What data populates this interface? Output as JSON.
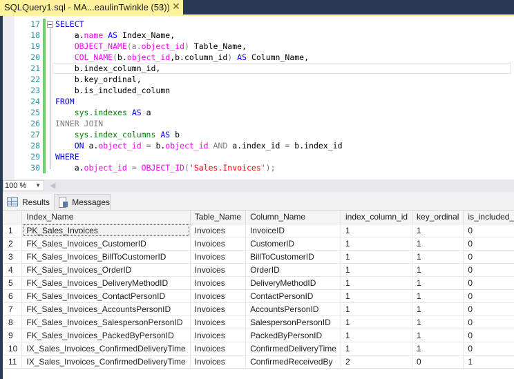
{
  "window": {
    "tab_title": "SQLQuery1.sql - MA...eaulinTwinkle (53))",
    "pin_icon": "pin-icon",
    "close_icon": "close-icon"
  },
  "editor": {
    "lines": [
      {
        "num": "17",
        "tokens": [
          {
            "t": "SELECT",
            "c": "kw"
          }
        ]
      },
      {
        "num": "18",
        "tokens": [
          {
            "t": "    a.",
            "c": ""
          },
          {
            "t": "name",
            "c": "fn"
          },
          {
            "t": " ",
            "c": ""
          },
          {
            "t": "AS",
            "c": "kw"
          },
          {
            "t": " Index_Name,",
            "c": ""
          }
        ]
      },
      {
        "num": "19",
        "tokens": [
          {
            "t": "    ",
            "c": ""
          },
          {
            "t": "OBJECT_NAME",
            "c": "fn"
          },
          {
            "t": "(a.",
            "c": "gr"
          },
          {
            "t": "object_id",
            "c": "fn"
          },
          {
            "t": ")",
            "c": "gr"
          },
          {
            "t": " Table_Name,",
            "c": ""
          }
        ]
      },
      {
        "num": "20",
        "tokens": [
          {
            "t": "    ",
            "c": ""
          },
          {
            "t": "COL_NAME",
            "c": "fn"
          },
          {
            "t": "(",
            "c": "gr"
          },
          {
            "t": "b.",
            "c": ""
          },
          {
            "t": "object_id",
            "c": "fn"
          },
          {
            "t": ",b.column_id",
            "c": ""
          },
          {
            "t": ") ",
            "c": "gr"
          },
          {
            "t": "AS",
            "c": "kw"
          },
          {
            "t": " Column_Name,",
            "c": ""
          }
        ]
      },
      {
        "num": "21",
        "tokens": [
          {
            "t": "    b.index_column_id,",
            "c": ""
          }
        ]
      },
      {
        "num": "22",
        "tokens": [
          {
            "t": "    b.key_ordinal,",
            "c": ""
          }
        ]
      },
      {
        "num": "23",
        "tokens": [
          {
            "t": "    b.is_included_column",
            "c": ""
          }
        ]
      },
      {
        "num": "24",
        "tokens": [
          {
            "t": "FROM",
            "c": "kw"
          }
        ]
      },
      {
        "num": "25",
        "tokens": [
          {
            "t": "    ",
            "c": ""
          },
          {
            "t": "sys.indexes",
            "c": "sys"
          },
          {
            "t": " ",
            "c": ""
          },
          {
            "t": "AS",
            "c": "kw"
          },
          {
            "t": " a",
            "c": ""
          }
        ]
      },
      {
        "num": "26",
        "tokens": [
          {
            "t": "INNER JOIN",
            "c": "gr"
          }
        ]
      },
      {
        "num": "27",
        "tokens": [
          {
            "t": "    ",
            "c": ""
          },
          {
            "t": "sys.index_columns",
            "c": "sys"
          },
          {
            "t": " ",
            "c": ""
          },
          {
            "t": "AS",
            "c": "kw"
          },
          {
            "t": " b",
            "c": ""
          }
        ]
      },
      {
        "num": "28",
        "tokens": [
          {
            "t": "    ",
            "c": ""
          },
          {
            "t": "ON",
            "c": "kw"
          },
          {
            "t": " a.",
            "c": ""
          },
          {
            "t": "object_id",
            "c": "fn"
          },
          {
            "t": " = ",
            "c": "gr"
          },
          {
            "t": "b.",
            "c": ""
          },
          {
            "t": "object_id",
            "c": "fn"
          },
          {
            "t": " AND ",
            "c": "gr"
          },
          {
            "t": "a.index_id ",
            "c": ""
          },
          {
            "t": "=",
            "c": "gr"
          },
          {
            "t": " b.index_id",
            "c": ""
          }
        ]
      },
      {
        "num": "29",
        "tokens": [
          {
            "t": "WHERE",
            "c": "kw"
          }
        ]
      },
      {
        "num": "30",
        "tokens": [
          {
            "t": "    a.",
            "c": ""
          },
          {
            "t": "object_id",
            "c": "fn"
          },
          {
            "t": " = ",
            "c": "gr"
          },
          {
            "t": "OBJECT_ID",
            "c": "fn"
          },
          {
            "t": "(",
            "c": "gr"
          },
          {
            "t": "'Sales.Invoices'",
            "c": "str"
          },
          {
            "t": ");",
            "c": "gr"
          }
        ]
      }
    ]
  },
  "zoom": {
    "value": "100 %"
  },
  "results": {
    "tabs": [
      {
        "label": "Results",
        "icon": "grid-icon",
        "active": true
      },
      {
        "label": "Messages",
        "icon": "messages-icon",
        "active": false
      }
    ],
    "columns": [
      "Index_Name",
      "Table_Name",
      "Column_Name",
      "index_column_id",
      "key_ordinal",
      "is_included_column"
    ],
    "rows": [
      [
        "1",
        "PK_Sales_Invoices",
        "Invoices",
        "InvoiceID",
        "1",
        "1",
        "0"
      ],
      [
        "2",
        "FK_Sales_Invoices_CustomerID",
        "Invoices",
        "CustomerID",
        "1",
        "1",
        "0"
      ],
      [
        "3",
        "FK_Sales_Invoices_BillToCustomerID",
        "Invoices",
        "BillToCustomerID",
        "1",
        "1",
        "0"
      ],
      [
        "4",
        "FK_Sales_Invoices_OrderID",
        "Invoices",
        "OrderID",
        "1",
        "1",
        "0"
      ],
      [
        "5",
        "FK_Sales_Invoices_DeliveryMethodID",
        "Invoices",
        "DeliveryMethodID",
        "1",
        "1",
        "0"
      ],
      [
        "6",
        "FK_Sales_Invoices_ContactPersonID",
        "Invoices",
        "ContactPersonID",
        "1",
        "1",
        "0"
      ],
      [
        "7",
        "FK_Sales_Invoices_AccountsPersonID",
        "Invoices",
        "AccountsPersonID",
        "1",
        "1",
        "0"
      ],
      [
        "8",
        "FK_Sales_Invoices_SalespersonPersonID",
        "Invoices",
        "SalespersonPersonID",
        "1",
        "1",
        "0"
      ],
      [
        "9",
        "FK_Sales_Invoices_PackedByPersonID",
        "Invoices",
        "PackedByPersonID",
        "1",
        "1",
        "0"
      ],
      [
        "10",
        "IX_Sales_Invoices_ConfirmedDeliveryTime",
        "Invoices",
        "ConfirmedDeliveryTime",
        "1",
        "1",
        "0"
      ],
      [
        "11",
        "IX_Sales_Invoices_ConfirmedDeliveryTime",
        "Invoices",
        "ConfirmedReceivedBy",
        "2",
        "0",
        "1"
      ]
    ]
  }
}
